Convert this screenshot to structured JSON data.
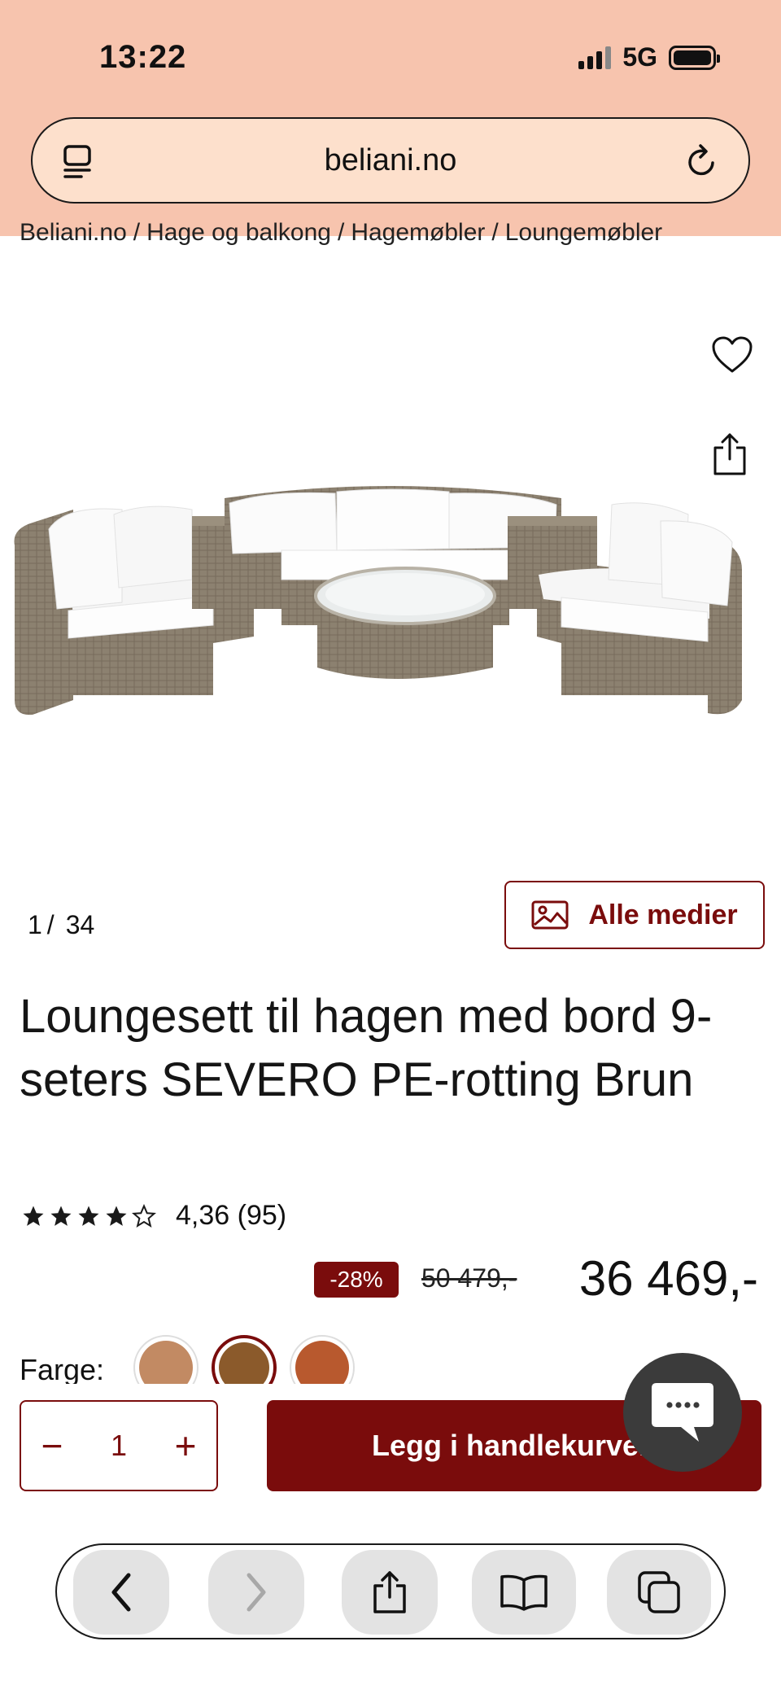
{
  "status": {
    "time": "13:22",
    "network": "5G"
  },
  "browser": {
    "url": "beliani.no"
  },
  "breadcrumb": [
    "Beliani.no",
    "Hage og balkong",
    "Hagemøbler",
    "Loungemøbler"
  ],
  "gallery": {
    "current": "1",
    "separator": "/",
    "total": "34",
    "all_media_label": "Alle medier"
  },
  "product": {
    "title": "Loungesett til hagen med bord 9-seters SEVERO PE-rotting Brun",
    "rating_value": 4.36,
    "rating_text": "4,36 (95)",
    "stars_filled": 4,
    "stars_total": 5
  },
  "pricing": {
    "discount": "-28%",
    "old_price": "50 479,-",
    "price": "36 469,-"
  },
  "color": {
    "label": "Farge:",
    "swatches": [
      {
        "color": "#c28a63",
        "selected": false
      },
      {
        "color": "#8b5a2b",
        "selected": true
      },
      {
        "color": "#b8592e",
        "selected": false
      }
    ]
  },
  "cart": {
    "quantity": "1",
    "minus": "−",
    "plus": "+",
    "add_label": "Legg i handlekurven"
  },
  "colors": {
    "brand": "#7a0c0c",
    "tint": "#f7c4ae"
  }
}
